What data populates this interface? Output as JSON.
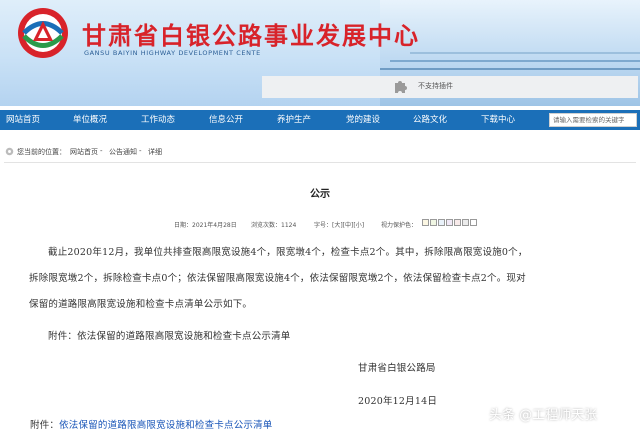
{
  "header": {
    "title": "甘肃省白银公路事业发展中心",
    "subtitle": "GANSU BAIYIN HIGHWAY DEVELOPMENT CENTE",
    "plugin_notice": "不支持插件"
  },
  "nav": {
    "items": [
      {
        "label": "网站首页"
      },
      {
        "label": "单位概况"
      },
      {
        "label": "工作动态"
      },
      {
        "label": "信息公开"
      },
      {
        "label": "养护生产"
      },
      {
        "label": "党的建设"
      },
      {
        "label": "公路文化"
      },
      {
        "label": "下载中心"
      }
    ],
    "search_placeholder": "请输入需要检索的关键字"
  },
  "breadcrumb": {
    "prefix": "您当前的位置：",
    "home": "网站首页",
    "sep1": " - ",
    "section": "公告通知",
    "sep2": " - ",
    "current": "详细"
  },
  "article": {
    "title": "公示",
    "date_label": "日期：2021年4月28日",
    "views_label": "浏览次数：1124",
    "font_size_label": "字号：[大][中][小]",
    "eye_protect_label": "视力保护色：",
    "eye_colors": [
      "#fcf7e3",
      "#f0f6e3",
      "#eaf2fa",
      "#f1e9f7",
      "#f8eaea",
      "#ebebeb",
      "#ffffff"
    ],
    "paragraph_lines": [
      "截止2020年12月，我单位共排查限高限宽设施4个，限宽墩4个，检查卡点2个。其中，拆除限高限宽设施0个，",
      "拆除限宽墩2个，拆除检查卡点0个；依法保留限高限宽设施4个，依法保留限宽墩2个，依法保留检查卡点2个。现对",
      "保留的道路限高限宽设施和检查卡点清单公示如下。"
    ],
    "attachment_text": "附件：依法保留的道路限高限宽设施和检查卡点公示清单",
    "signature_org": "甘肃省白银公路局",
    "signature_date": "2020年12月14日",
    "attachment_link_prefix": "附件：",
    "attachment_link_text": "依法保留的道路限高限宽设施和检查卡点公示清单"
  },
  "watermark": "头条 @工程师天张"
}
